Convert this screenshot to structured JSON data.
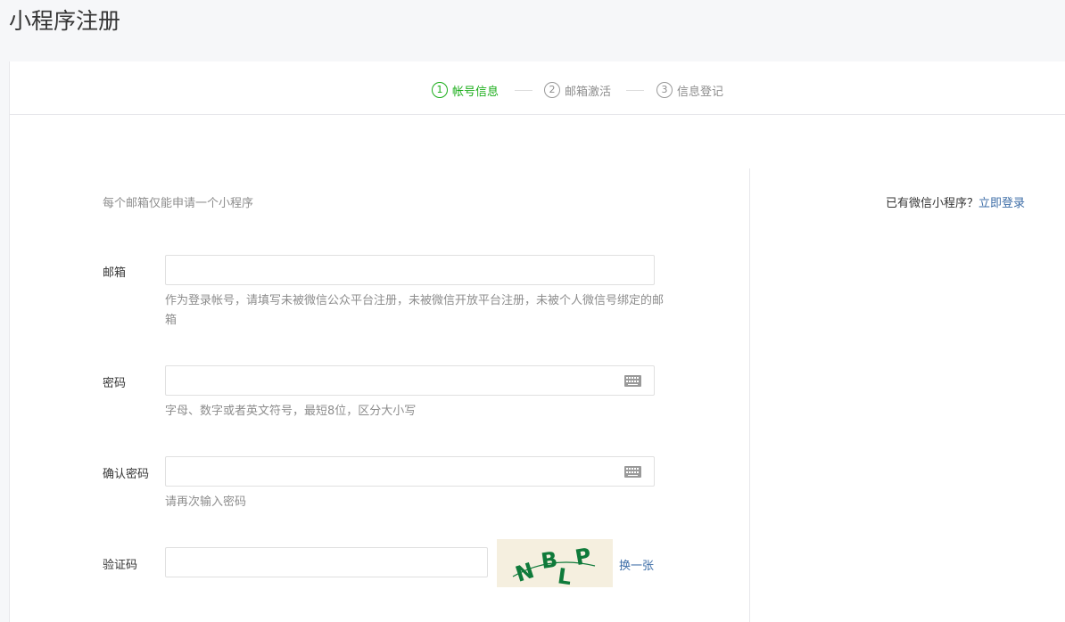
{
  "page": {
    "title": "小程序注册"
  },
  "steps": [
    {
      "num": "1",
      "label": "帐号信息",
      "active": true
    },
    {
      "num": "2",
      "label": "邮箱激活",
      "active": false
    },
    {
      "num": "3",
      "label": "信息登记",
      "active": false
    }
  ],
  "form": {
    "notice": "每个邮箱仅能申请一个小程序",
    "email": {
      "label": "邮箱",
      "value": "",
      "hint": "作为登录帐号，请填写未被微信公众平台注册，未被微信开放平台注册，未被个人微信号绑定的邮箱"
    },
    "password": {
      "label": "密码",
      "value": "",
      "hint": "字母、数字或者英文符号，最短8位，区分大小写"
    },
    "confirm_password": {
      "label": "确认密码",
      "value": "",
      "hint": "请再次输入密码"
    },
    "captcha": {
      "label": "验证码",
      "value": "",
      "image_text": "NBLP",
      "refresh_label": "换一张"
    }
  },
  "sidebar": {
    "login_prompt": "已有微信小程序？",
    "login_link": "立即登录"
  },
  "colors": {
    "accent_green": "#1aad19",
    "link_blue": "#3e6ea7",
    "captcha_text": "#0f7a3a"
  },
  "icons": {
    "password_keyboard": "keyboard-icon",
    "confirm_keyboard": "keyboard-icon"
  }
}
